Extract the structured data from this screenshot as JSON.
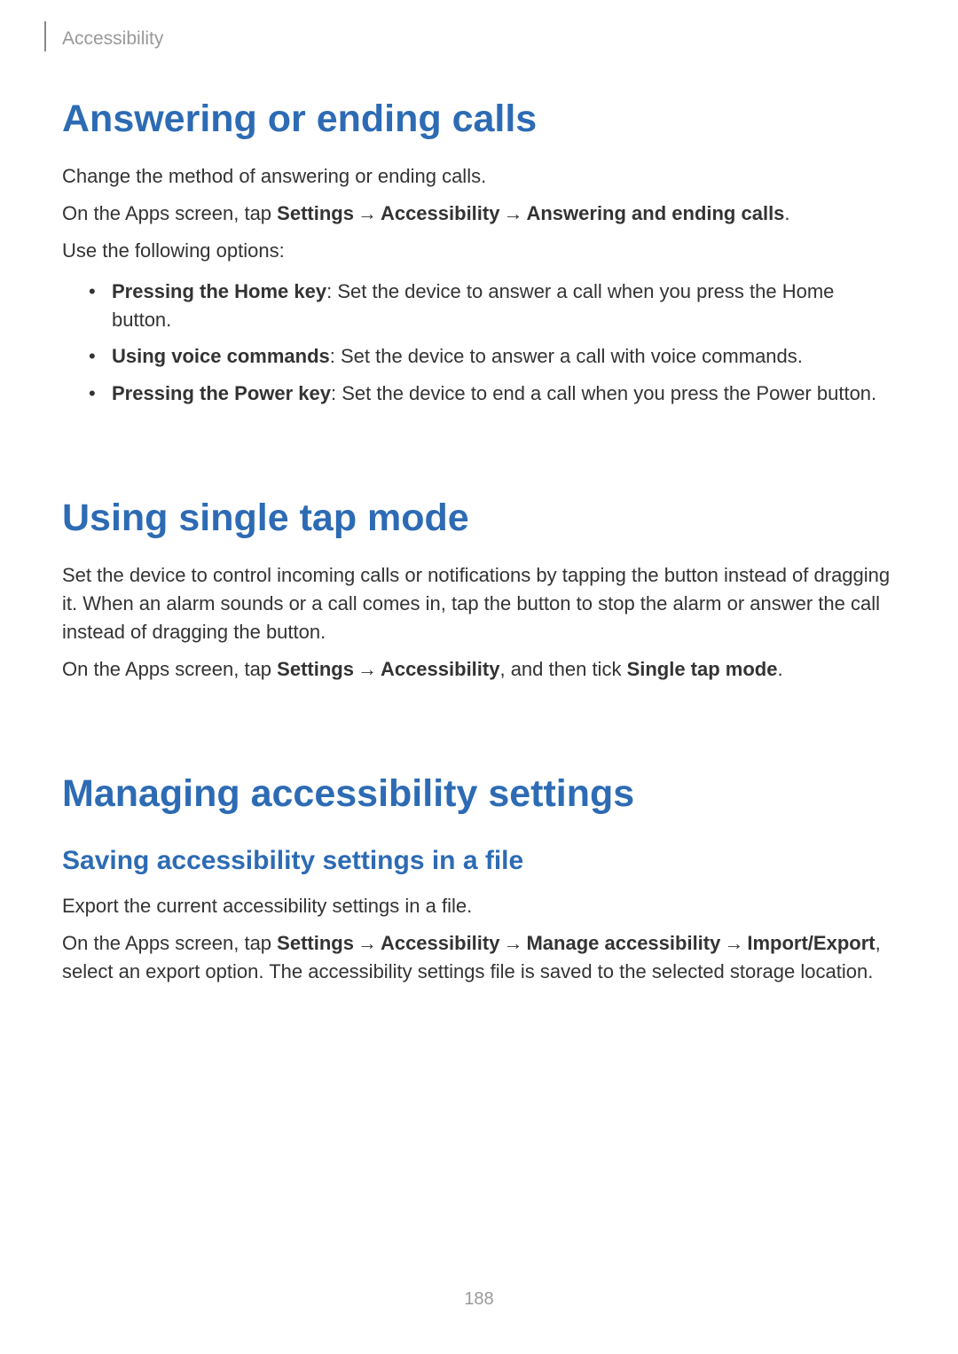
{
  "header": {
    "breadcrumb": "Accessibility"
  },
  "sections": {
    "answering_calls": {
      "title": "Answering or ending calls",
      "intro": "Change the method of answering or ending calls.",
      "instruction_pre": "On the Apps screen, tap ",
      "instruction_settings": "Settings",
      "instruction_accessibility": "Accessibility",
      "instruction_target": "Answering and ending calls",
      "instruction_post": ".",
      "options_intro": "Use the following options:",
      "bullet1_bold": "Pressing the Home key",
      "bullet1_text": ": Set the device to answer a call when you press the Home button.",
      "bullet2_bold": "Using voice commands",
      "bullet2_text": ": Set the device to answer a call with voice commands.",
      "bullet3_bold": "Pressing the Power key",
      "bullet3_text": ": Set the device to end a call when you press the Power button."
    },
    "single_tap": {
      "title": "Using single tap mode",
      "intro": "Set the device to control incoming calls or notifications by tapping the button instead of dragging it. When an alarm sounds or a call comes in, tap the button to stop the alarm or answer the call instead of dragging the button.",
      "instruction_pre": "On the Apps screen, tap ",
      "instruction_settings": "Settings",
      "instruction_accessibility": "Accessibility",
      "instruction_mid": ", and then tick ",
      "instruction_target": "Single tap mode",
      "instruction_post": "."
    },
    "managing": {
      "title": "Managing accessibility settings",
      "subtitle": "Saving accessibility settings in a file",
      "intro": "Export the current accessibility settings in a file.",
      "instruction_pre": "On the Apps screen, tap ",
      "instruction_settings": "Settings",
      "instruction_accessibility": "Accessibility",
      "instruction_manage": "Manage accessibility",
      "instruction_import_export": "Import/Export",
      "instruction_post": ", select an export option. The accessibility settings file is saved to the selected storage location."
    }
  },
  "arrow_symbol": "→",
  "page_number": "188"
}
